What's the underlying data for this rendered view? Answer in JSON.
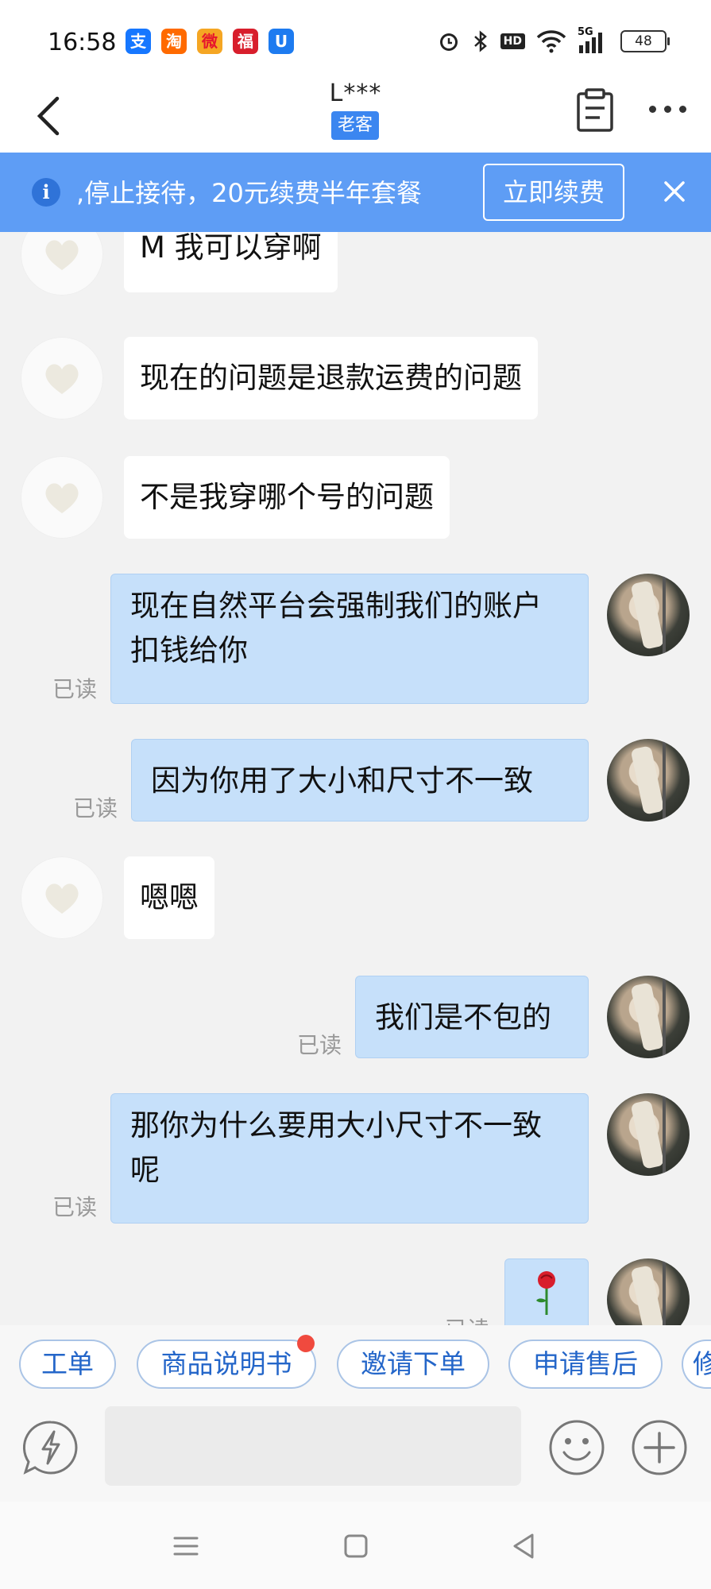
{
  "status_bar": {
    "time": "16:58",
    "apps": [
      {
        "icon": "alipay-icon",
        "glyph": "支",
        "color": "#1677ff"
      },
      {
        "icon": "taobao-icon",
        "glyph": "淘",
        "color": "#ff6a00"
      },
      {
        "icon": "weibo-icon",
        "glyph": "微",
        "color": "#e6162d"
      },
      {
        "icon": "app-red-icon",
        "glyph": "福",
        "color": "#d81e2c"
      },
      {
        "icon": "app-blue-icon",
        "glyph": "U",
        "color": "#1d7bf0"
      }
    ],
    "network": "5G",
    "hd": "HD",
    "battery": "48"
  },
  "header": {
    "title": "L***",
    "tag": "老客"
  },
  "banner": {
    "text": ",停止接待，20元续费半年套餐",
    "button_label": "立即续费"
  },
  "messages": [
    {
      "side": "in",
      "text": "M 我可以穿啊"
    },
    {
      "side": "in",
      "text": "现在的问题是退款运费的问题"
    },
    {
      "side": "in",
      "text": "不是我穿哪个号的问题"
    },
    {
      "side": "out",
      "text": "现在自然平台会强制我们的账户扣钱给你",
      "status": "已读"
    },
    {
      "side": "out",
      "text": "因为你用了大小和尺寸不一致",
      "status": "已读"
    },
    {
      "side": "in",
      "text": "嗯嗯"
    },
    {
      "side": "out",
      "text": "我们是不包的",
      "status": "已读"
    },
    {
      "side": "out",
      "text": "那你为什么要用大小尺寸不一致呢",
      "status": "已读"
    },
    {
      "side": "out",
      "text": "🌹",
      "status": "已读"
    }
  ],
  "quick_actions": [
    "工单",
    "商品说明书",
    "邀请下单",
    "申请售后",
    "修"
  ],
  "colors": {
    "accent": "#3b86f0",
    "banner": "#5e9df5",
    "outgoing_bubble": "#c6e0fa",
    "badge_dot": "#f04a3e"
  }
}
